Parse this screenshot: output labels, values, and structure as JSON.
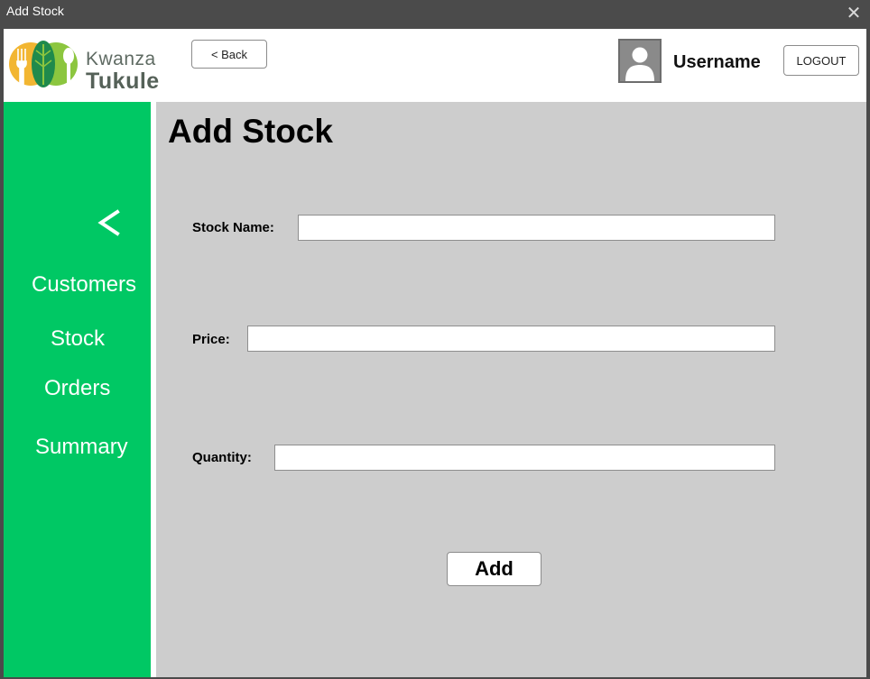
{
  "window": {
    "title": "Add Stock",
    "close_icon": "close-icon"
  },
  "header": {
    "brand_line1": "Kwanza",
    "brand_line2": "Tukule",
    "back_label": "< Back",
    "username": "Username",
    "logout_label": "LOGOUT"
  },
  "sidebar": {
    "collapse_icon": "chevron-left-icon",
    "items": [
      {
        "label": "Customers"
      },
      {
        "label": "Stock"
      },
      {
        "label": "Orders"
      },
      {
        "label": "Summary"
      }
    ]
  },
  "main": {
    "title": "Add Stock",
    "fields": [
      {
        "label": "Stock Name:",
        "value": ""
      },
      {
        "label": "Price:",
        "value": ""
      },
      {
        "label": "Quantity:",
        "value": ""
      }
    ],
    "add_label": "Add"
  },
  "colors": {
    "sidebar_green": "#00c864",
    "content_gray": "#cdcdcd",
    "titlebar": "#4b4b4b"
  }
}
